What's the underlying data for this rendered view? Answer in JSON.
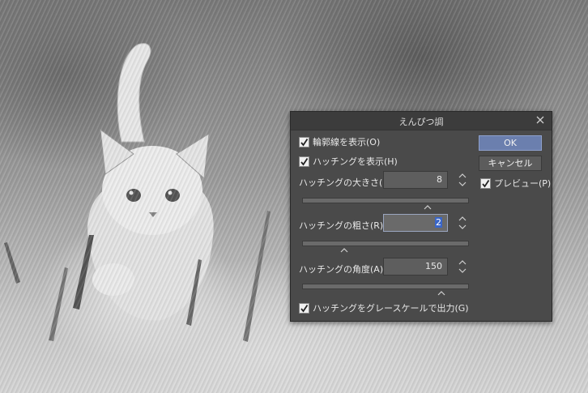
{
  "dialog": {
    "title": "えんぴつ調",
    "ok_label": "OK",
    "cancel_label": "キャンセル",
    "preview": {
      "label": "プレビュー(P)",
      "checked": true
    },
    "show_outline": {
      "label": "輪郭線を表示(O)",
      "checked": true
    },
    "show_hatching": {
      "label": "ハッチングを表示(H)",
      "checked": true
    },
    "hatch_size": {
      "label": "ハッチングの大きさ(S):",
      "value": "8",
      "slider_fraction": 0.75
    },
    "hatch_roughness": {
      "label": "ハッチングの粗さ(R):",
      "value": "2",
      "slider_fraction": 0.25
    },
    "hatch_angle": {
      "label": "ハッチングの角度(A):",
      "value": "150",
      "slider_fraction": 0.83
    },
    "grayscale": {
      "label": "ハッチングをグレースケールで出力(G)",
      "checked": true
    }
  },
  "icons": {
    "close": "close-icon",
    "check": "check-icon",
    "spinner": "spin-arrows-icon",
    "slider_thumb": "slider-thumb-icon"
  },
  "colors": {
    "dialog_bg": "#4a4a4a",
    "ok_button": "#6b7fae"
  }
}
